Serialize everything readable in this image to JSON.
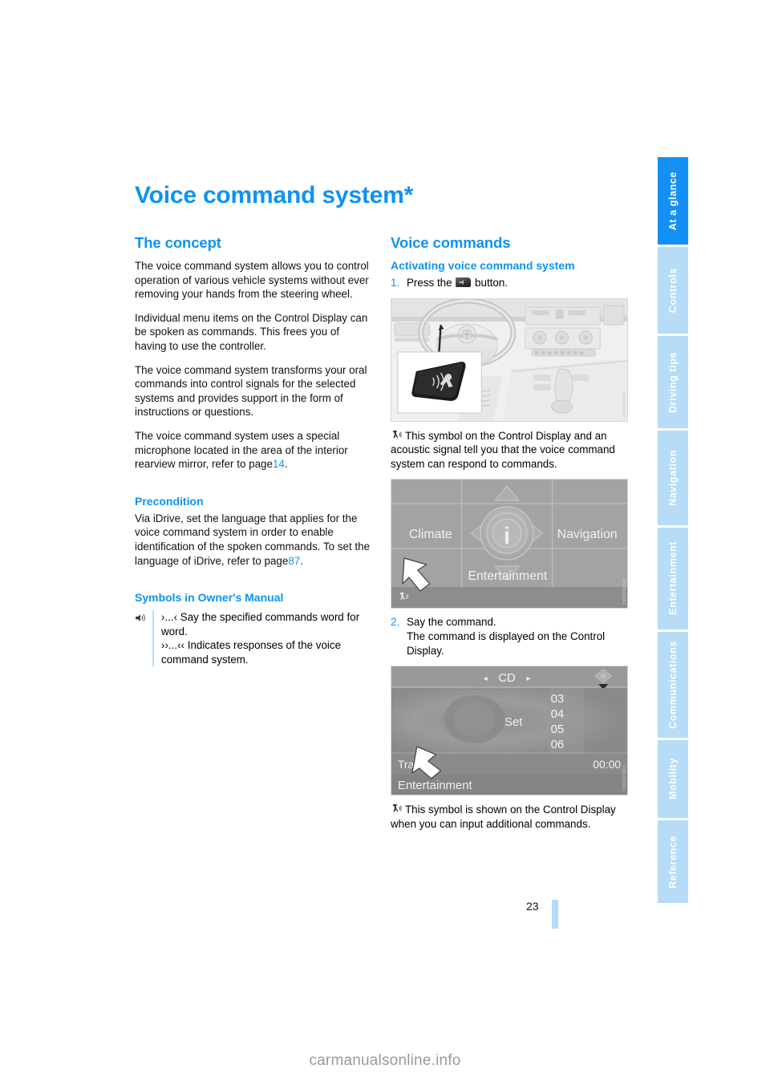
{
  "document": {
    "title": "Voice command system*",
    "page_number": "23",
    "watermark": "carmanualsonline.info"
  },
  "sidebar": {
    "tabs": [
      {
        "label": "At a glance",
        "active": true
      },
      {
        "label": "Controls",
        "active": false
      },
      {
        "label": "Driving tips",
        "active": false
      },
      {
        "label": "Navigation",
        "active": false
      },
      {
        "label": "Entertainment",
        "active": false
      },
      {
        "label": "Communications",
        "active": false
      },
      {
        "label": "Mobility",
        "active": false
      },
      {
        "label": "Reference",
        "active": false
      }
    ]
  },
  "colors": {
    "accent_blue": "#0d93f2",
    "tab_active": "#1490f5",
    "tab_inactive": "#b6dcf7"
  },
  "left_column": {
    "concept": {
      "heading": "The concept",
      "paragraphs": [
        "The voice command system allows you to control operation of various vehicle systems without ever removing your hands from the steering wheel.",
        "Individual menu items on the Control Display can be spoken as commands. This frees you of having to use the controller.",
        "The voice command system transforms your oral commands into control signals for the selected systems and provides support in the form of instructions or questions."
      ],
      "last_paragraph_before_ref": "The voice command system uses a special microphone located in the area of the interior rearview mirror, refer to page",
      "last_paragraph_ref": "14",
      "last_paragraph_after_ref": "."
    },
    "precondition": {
      "heading": "Precondition",
      "text_before_ref": "Via iDrive, set the language that applies for the voice command system in order to enable identification of the spoken commands. To set the language of iDrive, refer to page",
      "ref": "87",
      "text_after_ref": "."
    },
    "symbols": {
      "heading": "Symbols in Owner's Manual",
      "icon": "voice-command-icon",
      "line1": "›...‹ Say the specified commands word for word.",
      "line2": "››...‹‹ Indicates responses of the voice command system."
    }
  },
  "right_column": {
    "heading": "Voice commands",
    "activating": {
      "heading": "Activating voice command system",
      "step1": {
        "number": "1.",
        "text_before_button": "Press the",
        "button_icon": "voice-command-button-icon",
        "text_after_button": "button."
      },
      "figure_interior": {
        "name": "car-interior-photo",
        "code": "MV0K0230A"
      },
      "caption1": {
        "icon": "voice-active-icon",
        "text": "This symbol on the Control Display and an acoustic signal tell you that the voice command system can respond to commands."
      },
      "figure_idrive": {
        "name": "idrive-main-menu-screen",
        "code": "MV0B0A0A1",
        "menu_items": [
          "Climate",
          "Navigation",
          "Entertainment"
        ],
        "center_icon": "info-i-icon",
        "status_icon": "voice-active-icon"
      },
      "step2": {
        "number": "2.",
        "text": "Say the command.\nThe command is displayed on the Control Display."
      },
      "figure_cd": {
        "name": "cd-playback-screen",
        "code": "V3B1238661",
        "header": "CD",
        "center_label": "Set",
        "track_numbers": [
          "03",
          "04",
          "05",
          "06"
        ],
        "track_label": "Track",
        "time": "00:00",
        "footer": "Entertainment",
        "left_arrow": "◂",
        "right_arrow": "▸"
      },
      "caption2": {
        "icon": "voice-active-icon",
        "text": "This symbol is shown on the Control Display when you can input additional commands."
      }
    }
  }
}
